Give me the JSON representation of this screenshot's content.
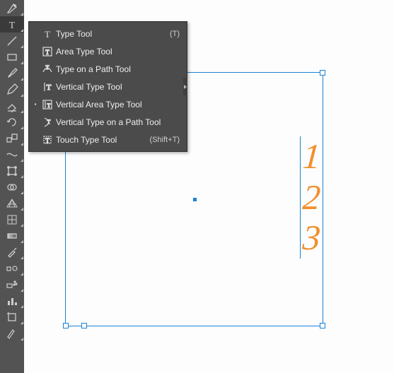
{
  "toolbox": {
    "tools": [
      {
        "name": "pen-tool"
      },
      {
        "name": "type-tool"
      },
      {
        "name": "line-segment-tool"
      },
      {
        "name": "rectangle-tool"
      },
      {
        "name": "paintbrush-tool"
      },
      {
        "name": "pencil-tool"
      },
      {
        "name": "eraser-tool"
      },
      {
        "name": "rotate-tool"
      },
      {
        "name": "scale-tool"
      },
      {
        "name": "width-tool"
      },
      {
        "name": "free-transform-tool"
      },
      {
        "name": "shape-builder-tool"
      },
      {
        "name": "perspective-grid-tool"
      },
      {
        "name": "mesh-tool"
      },
      {
        "name": "gradient-tool"
      },
      {
        "name": "eyedropper-tool"
      },
      {
        "name": "blend-tool"
      },
      {
        "name": "symbol-sprayer-tool"
      },
      {
        "name": "column-graph-tool"
      },
      {
        "name": "artboard-tool"
      },
      {
        "name": "slice-tool"
      }
    ],
    "selected_index": 1
  },
  "flyout": {
    "items": [
      {
        "label": "Type Tool",
        "shortcut": "(T)",
        "icon": "type-icon"
      },
      {
        "label": "Area Type Tool",
        "shortcut": "",
        "icon": "area-type-icon"
      },
      {
        "label": "Type on a Path Tool",
        "shortcut": "",
        "icon": "type-path-icon"
      },
      {
        "label": "Vertical Type Tool",
        "shortcut": "",
        "icon": "vertical-type-icon"
      },
      {
        "label": "Vertical Area Type Tool",
        "shortcut": "",
        "icon": "vertical-area-type-icon"
      },
      {
        "label": "Vertical Type on a Path Tool",
        "shortcut": "",
        "icon": "vertical-type-path-icon"
      },
      {
        "label": "Touch Type Tool",
        "shortcut": "(Shift+T)",
        "icon": "touch-type-icon"
      }
    ],
    "active_index": 4,
    "submenu_index": 3
  },
  "canvas": {
    "numbers": [
      "1",
      "2",
      "3"
    ]
  }
}
